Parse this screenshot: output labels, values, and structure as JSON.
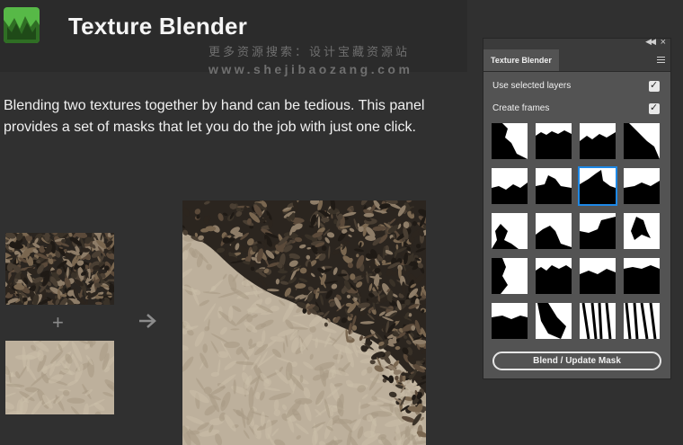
{
  "header": {
    "title": "Texture Blender",
    "watermark_line1": "更多资源搜索：设计宝藏资源站",
    "watermark_line2": "www.shejibaozang.com"
  },
  "description": "Blending two textures together by hand can be tedious. This panel provides a set of masks that let you do the job with just one click.",
  "diagram": {
    "plus": "+",
    "arrow_icon": "arrow-right-icon",
    "textures": [
      "leaf-litter-texture",
      "sand-texture",
      "blended-result-texture"
    ]
  },
  "panel": {
    "tab_label": "Texture Blender",
    "options": [
      {
        "label": "Use selected layers",
        "checked": true
      },
      {
        "label": "Create frames",
        "checked": true
      }
    ],
    "checkmark": "✓",
    "selected_mask": 6,
    "mask_count": 20,
    "button_label": "Blend / Update Mask"
  },
  "colors": {
    "logo_green": "#57b947",
    "panel_bg": "#535353",
    "page_bg": "#303030",
    "selection_blue": "#1e88e5"
  }
}
